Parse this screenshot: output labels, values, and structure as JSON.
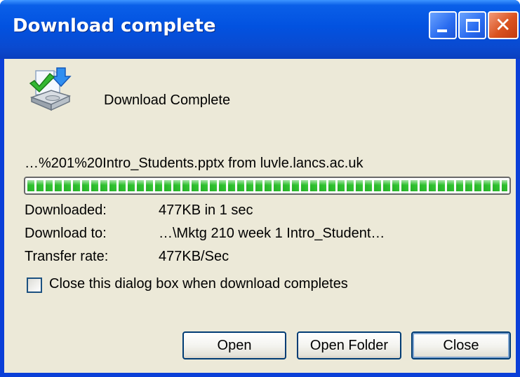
{
  "window": {
    "title": "Download complete",
    "controls": {
      "minimize_icon": "minimize-icon",
      "maximize_icon": "maximize-icon",
      "close_icon": "close-icon",
      "close_glyph": "✕"
    }
  },
  "dialog": {
    "icon": "download-complete-icon",
    "heading": "Download Complete",
    "file_line": "…%201%20Intro_Students.pptx from luvle.lancs.ac.uk",
    "progress_percent": 100,
    "info": [
      {
        "label": "Downloaded:",
        "value": "477KB in 1 sec"
      },
      {
        "label": "Download to:",
        "value": "…\\Mktg 210 week 1 Intro_Student…"
      },
      {
        "label": "Transfer rate:",
        "value": "477KB/Sec"
      }
    ],
    "close_when_complete": {
      "label": "Close this dialog box when download completes",
      "checked": false
    }
  },
  "buttons": {
    "open": "Open",
    "open_folder": "Open Folder",
    "close": "Close"
  },
  "colors": {
    "titlebar": "#0252e0",
    "progress": "#2ab82a",
    "dialog_bg": "#ece9d8"
  }
}
